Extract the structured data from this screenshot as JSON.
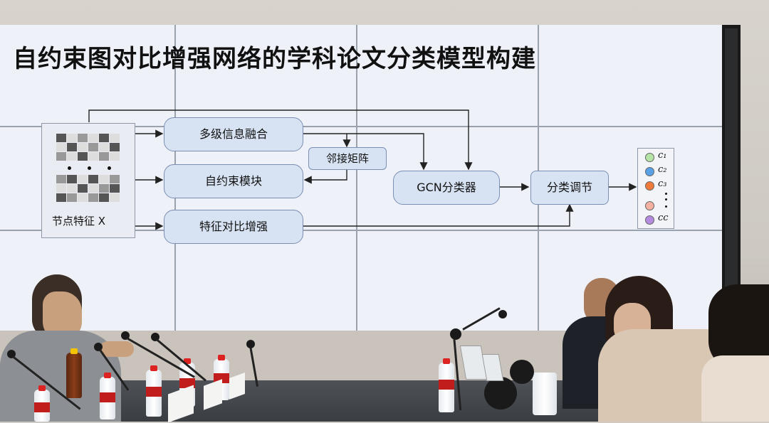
{
  "slide": {
    "title": "自约束图对比增强网络的学科论文分类模型构建",
    "feature_label": "节点特征 X",
    "boxes": {
      "fusion": "多级信息融合",
      "self_constraint": "自约束模块",
      "contrast": "特征对比增强",
      "adjacency": "邻接矩阵",
      "gcn": "GCN分类器",
      "adjust": "分类调节"
    },
    "classes": [
      {
        "label": "c₁",
        "color": "#b6e3a6"
      },
      {
        "label": "c₂",
        "color": "#5aa0e6"
      },
      {
        "label": "c₃",
        "color": "#f07a3a"
      },
      {
        "label": "c꜀",
        "color": "#f4b0a0"
      },
      {
        "label": "cc",
        "color": "#b58be0"
      }
    ]
  }
}
